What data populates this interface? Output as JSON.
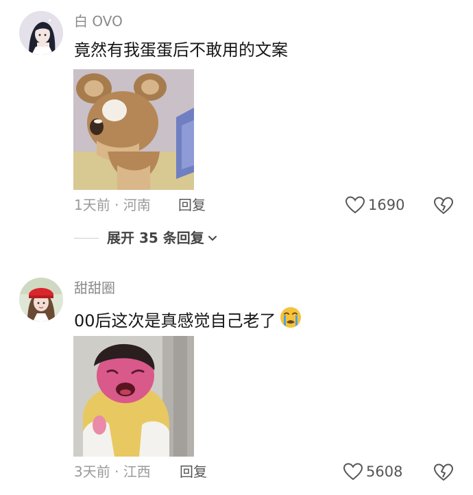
{
  "comments": [
    {
      "username": "白 OVO",
      "text": "竟然有我蛋蛋后不敢用的文案",
      "meta": "1天前 · 河南",
      "reply_label": "回复",
      "like_count": "1690",
      "expand_label": "展开 35 条回复",
      "avatar_icon": "girl-avatar",
      "image_desc": "cartoon-mouse-meme"
    },
    {
      "username": "甜甜圈",
      "text": "00后这次是真感觉自己老了",
      "emoji": "crying-face-emoji",
      "meta": "3天前 · 江西",
      "reply_label": "回复",
      "like_count": "5608",
      "avatar_icon": "girl-red-hat-avatar",
      "image_desc": "crying-baby-meme"
    }
  ],
  "colors": {
    "text_primary": "#161616",
    "text_secondary": "#8a8a8a",
    "meta": "#9a9a9a",
    "icon": "#555555",
    "emoji_face": "#f6c23a",
    "emoji_tear": "#4aa3e8"
  }
}
